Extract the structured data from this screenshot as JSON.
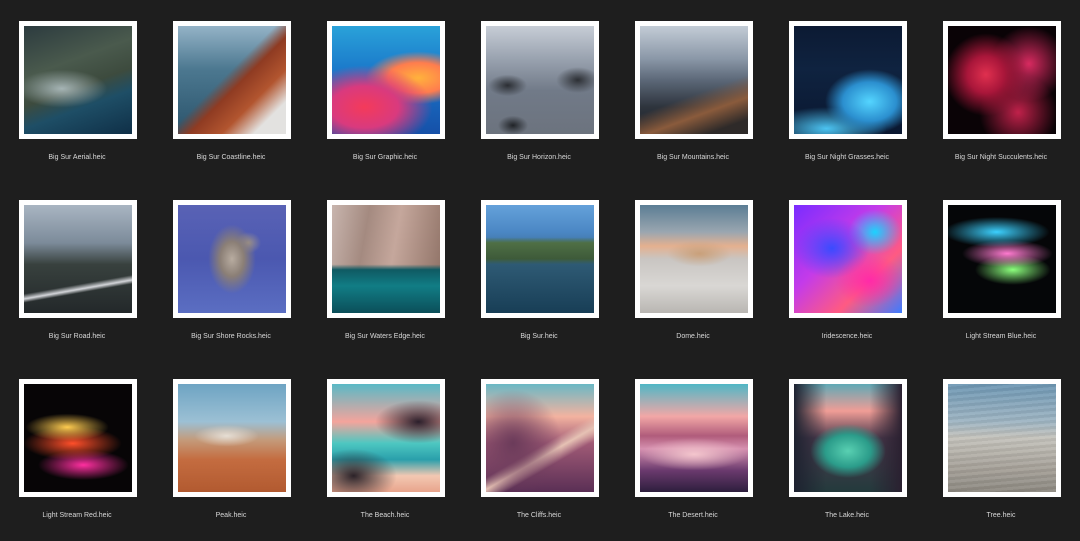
{
  "files": [
    {
      "name": "Big Sur Aerial.heic",
      "thumb": "t-aerial"
    },
    {
      "name": "Big Sur Coastline.heic",
      "thumb": "t-coast"
    },
    {
      "name": "Big Sur Graphic.heic",
      "thumb": "t-graphic"
    },
    {
      "name": "Big Sur Horizon.heic",
      "thumb": "t-horizon"
    },
    {
      "name": "Big Sur Mountains.heic",
      "thumb": "t-mountains"
    },
    {
      "name": "Big Sur Night Grasses.heic",
      "thumb": "t-grasses"
    },
    {
      "name": "Big Sur Night Succulents.heic",
      "thumb": "t-succulents"
    },
    {
      "name": "Big Sur Road.heic",
      "thumb": "t-road"
    },
    {
      "name": "Big Sur Shore Rocks.heic",
      "thumb": "t-shore"
    },
    {
      "name": "Big Sur Waters Edge.heic",
      "thumb": "t-waters"
    },
    {
      "name": "Big Sur.heic",
      "thumb": "t-bigsur"
    },
    {
      "name": "Dome.heic",
      "thumb": "t-dome"
    },
    {
      "name": "Iridescence.heic",
      "thumb": "t-irid"
    },
    {
      "name": "Light Stream Blue.heic",
      "thumb": "t-lsblue"
    },
    {
      "name": "Light Stream Red.heic",
      "thumb": "t-lsred"
    },
    {
      "name": "Peak.heic",
      "thumb": "t-peak"
    },
    {
      "name": "The Beach.heic",
      "thumb": "t-beach"
    },
    {
      "name": "The Cliffs.heic",
      "thumb": "t-cliffs"
    },
    {
      "name": "The Desert.heic",
      "thumb": "t-desert"
    },
    {
      "name": "The Lake.heic",
      "thumb": "t-lake"
    },
    {
      "name": "Tree.heic",
      "thumb": "t-tree"
    }
  ]
}
